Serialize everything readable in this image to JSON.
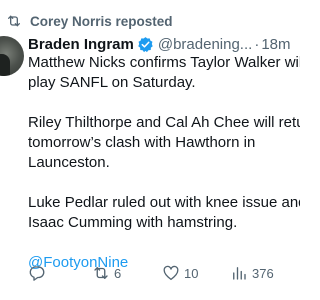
{
  "repost_banner": {
    "text": "Corey Norris reposted",
    "icon": "repost-icon"
  },
  "author": {
    "display_name": "Braden Ingram",
    "verified_icon": "verified-badge-icon",
    "handle": "@bradening...",
    "separator": "·",
    "time": "18m"
  },
  "tweet": {
    "paragraphs": [
      "Matthew Nicks confirms Taylor Walker will\nplay SANFL on Saturday.",
      "Riley Thilthorpe and Cal Ah Chee will return\ntomorrow’s clash with Hawthorn in\nLaunceston.",
      "Luke Pedlar ruled out with knee issue and\nIsaac Cumming with hamstring."
    ],
    "link": "@FootyonNine"
  },
  "actions": {
    "reply": {
      "icon": "reply-icon",
      "count": ""
    },
    "repost": {
      "icon": "repost-icon",
      "count": "6"
    },
    "like": {
      "icon": "heart-icon",
      "count": "10"
    },
    "views": {
      "icon": "views-chart-icon",
      "count": "376"
    },
    "share": {
      "icon": "share-icon",
      "count": ""
    }
  },
  "colors": {
    "accent": "#1d9bf0",
    "text": "#0f1419",
    "muted": "#536471"
  }
}
